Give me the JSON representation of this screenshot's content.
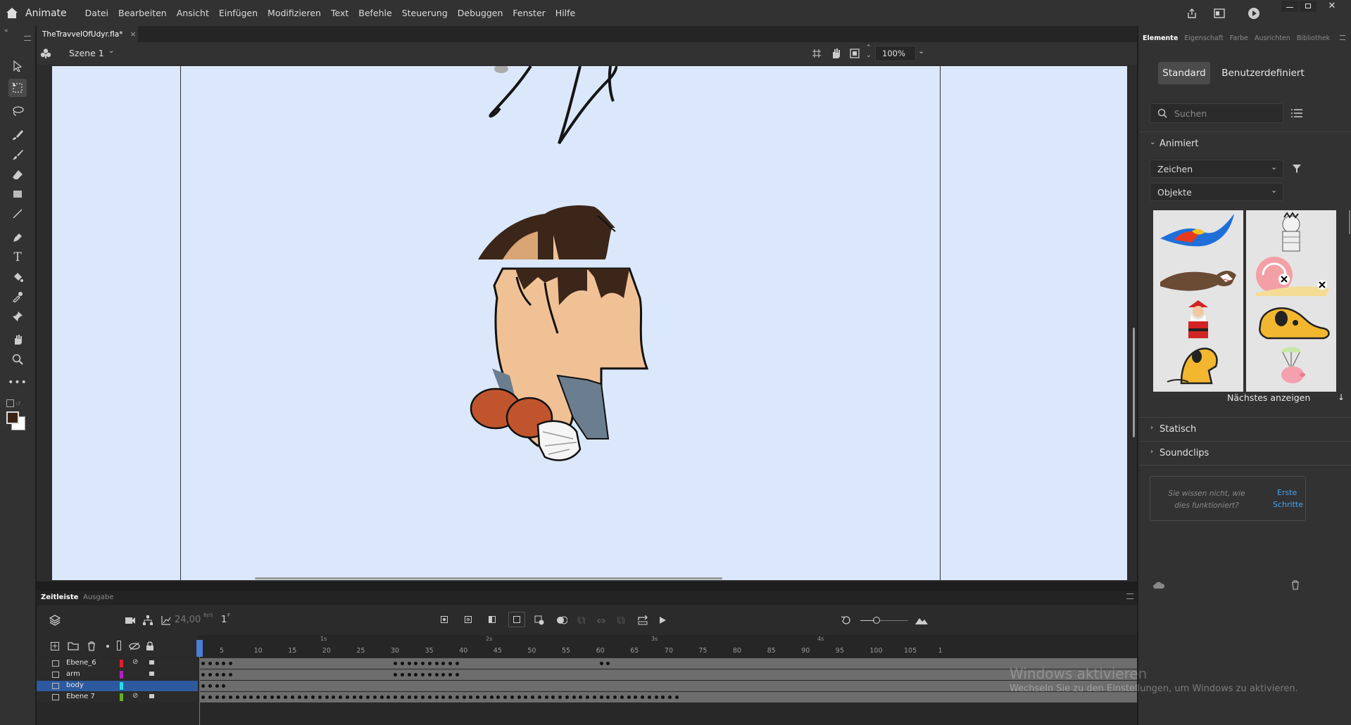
{
  "app": {
    "name": "Animate"
  },
  "menu": [
    "Datei",
    "Bearbeiten",
    "Ansicht",
    "Einfügen",
    "Modifizieren",
    "Text",
    "Befehle",
    "Steuerung",
    "Debuggen",
    "Fenster",
    "Hilfe"
  ],
  "document": {
    "tab_title": "TheTravvelOfUdyr.fla*",
    "close": "×"
  },
  "scene": {
    "label": "Szene 1"
  },
  "zoom": {
    "value": "100%"
  },
  "timeline": {
    "tabs": [
      "Zeitleiste",
      "Ausgabe"
    ],
    "fps": "24,00",
    "fps_unit": "BpS",
    "current_frame": "1",
    "frame_unit": "F",
    "ruler_ticks": [
      "5",
      "10",
      "15",
      "20",
      "25",
      "30",
      "35",
      "40",
      "45",
      "50",
      "55",
      "60",
      "65",
      "70",
      "75",
      "80",
      "85",
      "90",
      "95",
      "100",
      "105",
      "1"
    ],
    "seconds": [
      "1s",
      "2s",
      "3s",
      "4s"
    ],
    "layers": [
      {
        "name": "Ebene_6",
        "color": "#e0202a",
        "hidden": true,
        "locked": true,
        "selected": false
      },
      {
        "name": "arm",
        "color": "#b020c0",
        "hidden": false,
        "locked": true,
        "selected": false
      },
      {
        "name": "body",
        "color": "#22e0e8",
        "hidden": false,
        "locked": false,
        "selected": true
      },
      {
        "name": "Ebene 7",
        "color": "#60b020",
        "hidden": true,
        "locked": true,
        "selected": false
      }
    ]
  },
  "panel": {
    "tabs": [
      "Elemente",
      "Eigenschaft",
      "Farbe",
      "Ausrichten",
      "Bibliothek"
    ],
    "segment_standard": "Standard",
    "segment_custom": "Benutzerdefiniert",
    "search_placeholder": "Suchen",
    "section_animated": "Animiert",
    "dropdown_1": "Zeichen",
    "dropdown_2": "Objekte",
    "next_label": "Nächstes anzeigen",
    "section_static": "Statisch",
    "section_sound": "Soundclips",
    "help_text": "Sie wissen nicht, wie dies funktioniert?",
    "help_link_1": "Erste",
    "help_link_2": "Schritte"
  },
  "watermark": {
    "line1": "Windows aktivieren",
    "line2": "Wechseln Sie zu den Einstellungen, um Windows zu aktivieren."
  },
  "colors": {
    "stage": "#dbe8fc",
    "selection": "#2d5a9e",
    "playhead": "#4a7fd6"
  }
}
